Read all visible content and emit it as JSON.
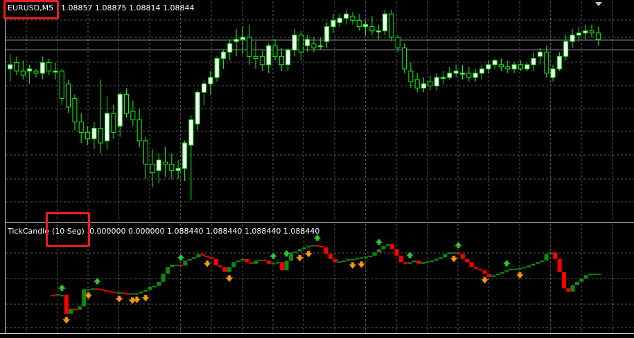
{
  "main_chart": {
    "symbol_label": "EURUSD,M5",
    "ohlc_text": "1.08857 1.08875 1.08814 1.08844",
    "colors": {
      "background": "#000000",
      "bull_body": "#ffffff",
      "bear_body": "#000000",
      "wick": "#00ff00",
      "highlight": "#ee1d23",
      "price_line": "#8a8a8a"
    }
  },
  "indicator": {
    "name": "TickCandle",
    "period_label": "(10 Seg)",
    "values_text": "0.000000 0.000000 1.088440 1.088440 1.088440 1.088440",
    "colors": {
      "bull": "#0e8a0e",
      "bear": "#ff0000",
      "arrow_up": "#2ecc2e",
      "arrow_down": "#ff9900"
    }
  },
  "chart_data": {
    "type": "candlestick",
    "title": "EURUSD,M5",
    "xlabel": "",
    "ylabel": "",
    "ylim": [
      0,
      10
    ],
    "grid": true,
    "candles": [
      [
        7.0,
        7.7,
        6.4,
        7.2
      ],
      [
        7.3,
        7.6,
        6.7,
        6.9
      ],
      [
        6.9,
        7.4,
        6.5,
        6.7
      ],
      [
        6.9,
        7.2,
        6.3,
        7.0
      ],
      [
        6.9,
        7.0,
        6.6,
        6.8
      ],
      [
        6.8,
        7.6,
        6.5,
        7.3
      ],
      [
        7.3,
        7.5,
        6.7,
        6.9
      ],
      [
        6.9,
        7.3,
        6.5,
        6.9
      ],
      [
        6.9,
        7.0,
        5.3,
        5.6
      ],
      [
        6.3,
        6.5,
        4.9,
        5.2
      ],
      [
        5.6,
        5.8,
        4.1,
        4.5
      ],
      [
        4.5,
        4.9,
        3.5,
        4.0
      ],
      [
        4.0,
        4.3,
        3.4,
        3.7
      ],
      [
        3.7,
        4.5,
        3.2,
        4.2
      ],
      [
        4.2,
        6.5,
        3.0,
        3.5
      ],
      [
        3.6,
        5.7,
        3.2,
        4.9
      ],
      [
        4.9,
        5.3,
        3.7,
        4.0
      ],
      [
        4.3,
        5.9,
        3.8,
        5.8
      ],
      [
        5.8,
        6.1,
        4.7,
        4.9
      ],
      [
        5.0,
        5.5,
        4.3,
        4.6
      ],
      [
        4.6,
        5.1,
        3.3,
        3.6
      ],
      [
        3.6,
        3.8,
        1.8,
        2.5
      ],
      [
        2.5,
        3.2,
        1.4,
        2.1
      ],
      [
        2.2,
        3.0,
        1.6,
        2.7
      ],
      [
        2.6,
        3.3,
        1.9,
        2.5
      ],
      [
        2.5,
        3.0,
        1.8,
        2.2
      ],
      [
        2.2,
        2.7,
        1.8,
        2.3
      ],
      [
        2.3,
        3.6,
        1.7,
        3.5
      ],
      [
        3.4,
        4.8,
        0.8,
        4.6
      ],
      [
        4.4,
        6.0,
        4.1,
        5.9
      ],
      [
        5.9,
        6.5,
        5.3,
        6.3
      ],
      [
        6.3,
        6.9,
        5.8,
        6.6
      ],
      [
        6.6,
        7.6,
        6.4,
        7.5
      ],
      [
        7.5,
        7.9,
        7.0,
        7.8
      ],
      [
        7.8,
        8.4,
        7.4,
        8.2
      ],
      [
        8.3,
        8.9,
        7.6,
        8.4
      ],
      [
        8.4,
        9.0,
        7.7,
        8.5
      ],
      [
        8.5,
        9.1,
        7.2,
        7.6
      ],
      [
        7.6,
        8.3,
        7.0,
        7.5
      ],
      [
        7.6,
        7.9,
        6.9,
        7.2
      ],
      [
        7.2,
        8.2,
        6.8,
        8.1
      ],
      [
        8.1,
        8.4,
        7.4,
        7.6
      ],
      [
        7.6,
        8.0,
        6.9,
        7.2
      ],
      [
        7.2,
        8.0,
        6.9,
        7.9
      ],
      [
        7.9,
        8.9,
        7.6,
        8.6
      ],
      [
        8.6,
        8.8,
        7.4,
        7.8
      ],
      [
        8.1,
        8.6,
        7.8,
        8.4
      ],
      [
        8.2,
        8.5,
        7.8,
        8.0
      ],
      [
        8.1,
        8.5,
        7.9,
        8.1
      ],
      [
        8.3,
        9.2,
        8.0,
        9.0
      ],
      [
        9.0,
        9.6,
        8.7,
        9.3
      ],
      [
        9.2,
        9.6,
        9.0,
        9.4
      ],
      [
        9.4,
        9.8,
        9.1,
        9.6
      ],
      [
        9.5,
        9.7,
        9.1,
        9.3
      ],
      [
        9.3,
        9.6,
        8.8,
        9.0
      ],
      [
        9.0,
        9.3,
        8.6,
        9.1
      ],
      [
        9.0,
        9.5,
        8.6,
        8.8
      ],
      [
        8.8,
        9.1,
        8.4,
        8.8
      ],
      [
        8.8,
        9.8,
        8.6,
        9.6
      ],
      [
        9.6,
        9.8,
        8.3,
        8.5
      ],
      [
        8.5,
        8.6,
        7.8,
        8.0
      ],
      [
        8.0,
        8.2,
        6.8,
        7.0
      ],
      [
        6.9,
        7.3,
        6.1,
        6.4
      ],
      [
        6.5,
        6.8,
        5.9,
        6.1
      ],
      [
        6.1,
        6.6,
        5.9,
        6.3
      ],
      [
        6.4,
        6.7,
        6.0,
        6.2
      ],
      [
        6.2,
        6.8,
        6.0,
        6.6
      ],
      [
        6.6,
        6.9,
        6.3,
        6.6
      ],
      [
        6.6,
        7.1,
        6.5,
        6.8
      ],
      [
        6.8,
        7.2,
        6.6,
        6.9
      ],
      [
        6.8,
        7.2,
        6.5,
        6.8
      ],
      [
        6.8,
        7.1,
        6.4,
        6.6
      ],
      [
        6.6,
        7.0,
        6.4,
        6.8
      ],
      [
        6.8,
        7.2,
        6.5,
        7.0
      ],
      [
        7.0,
        7.4,
        6.8,
        7.2
      ],
      [
        7.2,
        7.5,
        7.0,
        7.4
      ],
      [
        7.2,
        7.5,
        6.9,
        7.1
      ],
      [
        7.1,
        7.4,
        6.8,
        7.0
      ],
      [
        7.0,
        7.3,
        6.8,
        7.2
      ],
      [
        7.2,
        7.4,
        6.9,
        7.0
      ],
      [
        7.0,
        7.3,
        6.9,
        7.2
      ],
      [
        7.2,
        7.8,
        6.9,
        7.5
      ],
      [
        7.6,
        8.0,
        7.2,
        7.8
      ],
      [
        7.8,
        8.1,
        6.6,
        6.8
      ],
      [
        6.6,
        7.2,
        6.4,
        7.0
      ],
      [
        7.0,
        7.8,
        6.9,
        7.6
      ],
      [
        7.6,
        8.6,
        7.4,
        8.3
      ],
      [
        8.3,
        8.9,
        8.0,
        8.6
      ],
      [
        8.6,
        9.0,
        8.3,
        8.7
      ],
      [
        8.7,
        9.1,
        8.4,
        8.8
      ],
      [
        8.8,
        9.1,
        8.5,
        8.7
      ],
      [
        8.7,
        9.0,
        8.1,
        8.4
      ]
    ]
  },
  "indicator_data": {
    "bars": [
      [
        0.0,
        0.0
      ],
      [
        0.0,
        0.0
      ],
      [
        0.0,
        0.0
      ],
      [
        0.0,
        0.0
      ],
      [
        0.0,
        0.0
      ],
      [
        0.0,
        0.0
      ],
      [
        0.0,
        0.0
      ],
      [
        0.0,
        0.0
      ],
      [
        0.0,
        0.0
      ],
      [
        0.0,
        0.0
      ],
      [
        2.0,
        1.95
      ],
      [
        2.0,
        2.05
      ],
      [
        2.0,
        2.0
      ],
      [
        2.0,
        0.85
      ],
      [
        0.85,
        1.15
      ],
      [
        1.15,
        1.1
      ],
      [
        1.1,
        1.3
      ],
      [
        1.3,
        2.35
      ],
      [
        2.35,
        2.35
      ],
      [
        2.35,
        2.4
      ],
      [
        2.4,
        2.35
      ],
      [
        2.35,
        2.3
      ],
      [
        2.3,
        2.25
      ],
      [
        2.25,
        2.2
      ],
      [
        2.2,
        2.15
      ],
      [
        2.15,
        2.15
      ],
      [
        2.15,
        2.1
      ],
      [
        2.1,
        2.05
      ],
      [
        2.05,
        2.1
      ],
      [
        2.1,
        2.1
      ],
      [
        2.1,
        2.2
      ],
      [
        2.2,
        2.3
      ],
      [
        2.3,
        2.5
      ],
      [
        2.5,
        2.55
      ],
      [
        2.55,
        2.8
      ],
      [
        2.8,
        3.3
      ],
      [
        3.3,
        3.7
      ],
      [
        3.7,
        3.85
      ],
      [
        3.85,
        3.85
      ],
      [
        3.85,
        3.8
      ],
      [
        3.8,
        4.1
      ],
      [
        4.1,
        4.2
      ],
      [
        4.2,
        4.3
      ],
      [
        4.3,
        4.5
      ],
      [
        4.5,
        4.4
      ],
      [
        4.4,
        4.3
      ],
      [
        4.3,
        4.2
      ],
      [
        4.2,
        3.8
      ],
      [
        3.8,
        3.7
      ],
      [
        3.7,
        3.4
      ],
      [
        3.4,
        3.7
      ],
      [
        3.7,
        4.0
      ],
      [
        4.0,
        4.1
      ],
      [
        4.1,
        4.2
      ],
      [
        4.2,
        4.0
      ],
      [
        4.0,
        3.9
      ],
      [
        3.9,
        4.1
      ],
      [
        4.1,
        4.15
      ],
      [
        4.15,
        4.1
      ],
      [
        4.1,
        3.9
      ],
      [
        3.9,
        3.95
      ],
      [
        3.95,
        4.0
      ],
      [
        4.0,
        3.5
      ],
      [
        3.5,
        4.1
      ],
      [
        4.1,
        4.6
      ],
      [
        4.6,
        4.65
      ],
      [
        4.65,
        4.8
      ],
      [
        4.8,
        4.9
      ],
      [
        4.9,
        5.0
      ],
      [
        5.0,
        5.05
      ],
      [
        5.05,
        5.0
      ],
      [
        5.0,
        4.9
      ],
      [
        4.9,
        4.5
      ],
      [
        4.5,
        4.2
      ],
      [
        4.2,
        4.0
      ],
      [
        4.0,
        4.05
      ],
      [
        4.05,
        4.1
      ],
      [
        4.1,
        4.2
      ],
      [
        4.2,
        4.2
      ],
      [
        4.2,
        4.25
      ],
      [
        4.25,
        4.3
      ],
      [
        4.3,
        4.35
      ],
      [
        4.35,
        4.4
      ],
      [
        4.4,
        4.6
      ],
      [
        4.6,
        4.8
      ],
      [
        4.8,
        5.0
      ],
      [
        5.0,
        5.1
      ],
      [
        5.1,
        4.8
      ],
      [
        4.8,
        4.4
      ],
      [
        4.4,
        4.0
      ],
      [
        4.0,
        3.9
      ],
      [
        3.9,
        4.0
      ],
      [
        4.0,
        4.1
      ],
      [
        4.1,
        3.9
      ],
      [
        3.9,
        4.0
      ],
      [
        4.0,
        4.05
      ],
      [
        4.05,
        4.1
      ],
      [
        4.1,
        4.2
      ],
      [
        4.2,
        4.3
      ],
      [
        4.3,
        4.5
      ],
      [
        4.5,
        4.6
      ],
      [
        4.6,
        4.6
      ],
      [
        4.6,
        4.5
      ],
      [
        4.5,
        4.2
      ],
      [
        4.2,
        4.0
      ],
      [
        4.0,
        3.7
      ],
      [
        3.7,
        3.6
      ],
      [
        3.6,
        3.5
      ],
      [
        3.5,
        3.3
      ],
      [
        3.3,
        3.1
      ],
      [
        3.1,
        3.2
      ],
      [
        3.2,
        3.3
      ],
      [
        3.3,
        3.4
      ],
      [
        3.4,
        3.5
      ],
      [
        3.5,
        3.6
      ],
      [
        3.6,
        3.6
      ],
      [
        3.6,
        3.65
      ],
      [
        3.65,
        3.7
      ],
      [
        3.7,
        3.8
      ],
      [
        3.8,
        3.9
      ],
      [
        3.9,
        4.0
      ],
      [
        4.0,
        4.1
      ],
      [
        4.1,
        4.5
      ],
      [
        4.5,
        4.6
      ],
      [
        4.6,
        4.2
      ],
      [
        4.2,
        3.4
      ],
      [
        3.4,
        2.4
      ],
      [
        2.4,
        2.2
      ],
      [
        2.2,
        2.6
      ],
      [
        2.6,
        2.8
      ],
      [
        2.8,
        3.0
      ],
      [
        3.0,
        3.2
      ],
      [
        3.2,
        3.3
      ],
      [
        3.3,
        3.3
      ],
      [
        3.3,
        3.3
      ]
    ],
    "arrows_up": [
      12,
      20,
      39,
      60,
      63,
      70,
      84,
      91,
      102,
      113
    ],
    "arrows_down": [
      13,
      18,
      25,
      28,
      29,
      31,
      45,
      50,
      66,
      68,
      78,
      80,
      101,
      108,
      116
    ],
    "ylim": [
      0,
      6
    ]
  }
}
